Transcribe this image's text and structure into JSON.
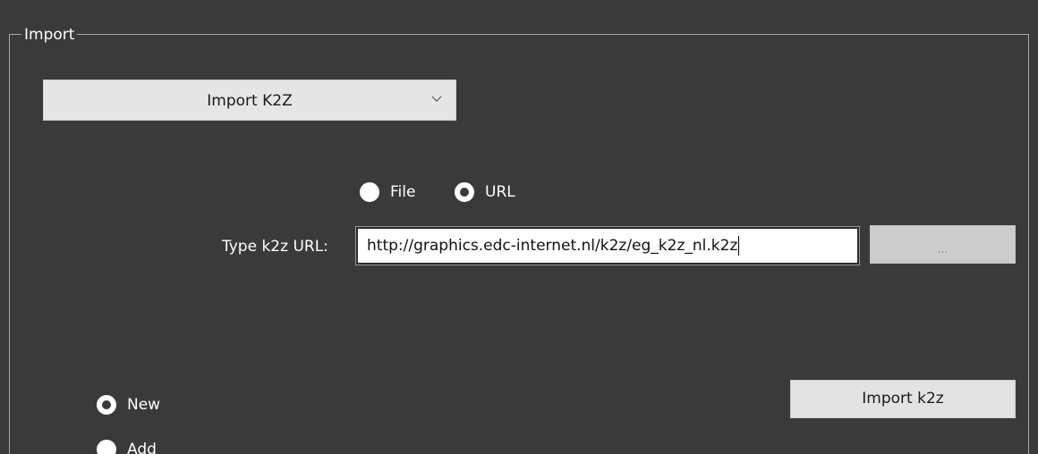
{
  "group": {
    "title": "Import"
  },
  "import_type": {
    "selected": "Import K2Z",
    "icon": "chevron-down-icon"
  },
  "source": {
    "options": [
      {
        "label": "File",
        "checked": false
      },
      {
        "label": "URL",
        "checked": true
      }
    ]
  },
  "url_field": {
    "label": "Type k2z URL:",
    "value": "http://graphics.edc-internet.nl/k2z/eg_k2z_nl.k2z"
  },
  "browse_button": {
    "label": "..."
  },
  "mode": {
    "options": [
      {
        "label": "New",
        "checked": true
      },
      {
        "label": "Add",
        "checked": false
      }
    ]
  },
  "import_button": {
    "label": "Import k2z"
  },
  "colors": {
    "background": "#3a3a3a",
    "border": "#a8a8a8",
    "button_bg": "#e3e3e3"
  }
}
